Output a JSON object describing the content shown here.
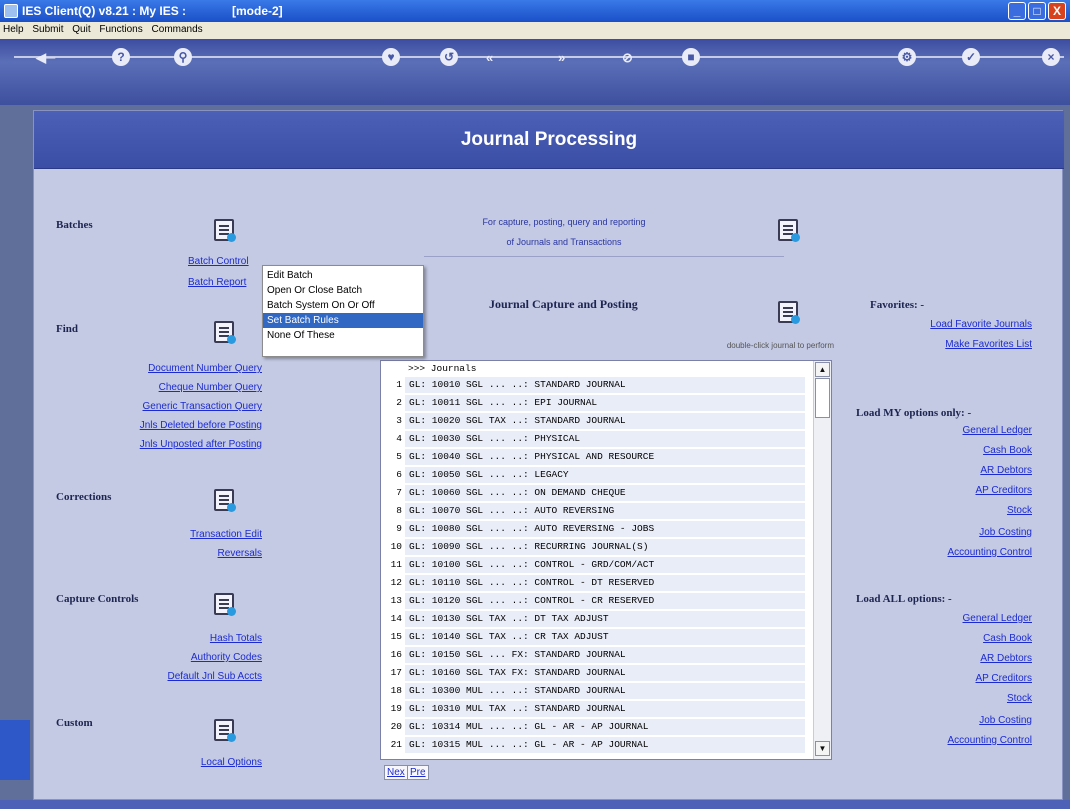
{
  "window": {
    "title": "IES Client(Q) v8.21 : My IES :",
    "mode": "[mode-2]",
    "controls": [
      "_",
      "□",
      "X"
    ]
  },
  "menu": [
    "Help",
    "Submit",
    "Quit",
    "Functions",
    "Commands"
  ],
  "toolbar": {
    "icons": [
      "back-icon",
      "help-icon",
      "search-icon",
      "favorite-icon",
      "undo-icon",
      "prev-icon",
      "next-icon",
      "stop-icon",
      "record-icon",
      "settings-icon",
      "confirm-icon",
      "close-icon"
    ]
  },
  "header": {
    "title": "Journal Processing"
  },
  "batches": {
    "title": "Batches",
    "links": [
      "Batch Control",
      "Batch Report"
    ]
  },
  "find": {
    "title": "Find",
    "links": [
      "Document Number Query",
      "Cheque Number Query",
      "Generic Transaction Query",
      "Jnls Deleted before Posting",
      "Jnls Unposted after Posting"
    ]
  },
  "corrections": {
    "title": "Corrections",
    "links": [
      "Transaction Edit",
      "Reversals"
    ]
  },
  "capture_controls": {
    "title": "Capture Controls",
    "links": [
      "Hash Totals",
      "Authority Codes",
      "Default Jnl Sub Accts"
    ]
  },
  "custom": {
    "title": "Custom",
    "links": [
      "Local Options"
    ]
  },
  "info": {
    "line1": "For capture, posting, query and reporting",
    "line2": "of Journals and Transactions"
  },
  "capture": {
    "title": "Journal Capture and Posting",
    "hint": "double-click journal to perform"
  },
  "favorites": {
    "title": "Favorites: -",
    "links": [
      "Load Favorite Journals",
      "Make Favorites List"
    ]
  },
  "load_my": {
    "title": "Load MY options only: -",
    "links": [
      "General Ledger",
      "Cash Book",
      "AR Debtors",
      "AP Creditors",
      "Stock",
      "Job Costing",
      "Accounting Control"
    ]
  },
  "load_all": {
    "title": "Load ALL options: -",
    "links": [
      "General Ledger",
      "Cash Book",
      "AR Debtors",
      "AP Creditors",
      "Stock",
      "Job Costing",
      "Accounting Control"
    ]
  },
  "context_menu": {
    "items": [
      "Edit Batch",
      "Open Or Close Batch",
      "Batch System On Or Off",
      "Set Batch Rules",
      "None Of These"
    ],
    "selected": "Set Batch Rules"
  },
  "journals": {
    "header": ">>> Journals",
    "rows": [
      {
        "n": "1",
        "t": "GL: 10010 SGL ... ..: STANDARD JOURNAL"
      },
      {
        "n": "2",
        "t": "GL: 10011 SGL ... ..: EPI JOURNAL"
      },
      {
        "n": "3",
        "t": "GL: 10020 SGL TAX ..: STANDARD JOURNAL"
      },
      {
        "n": "4",
        "t": "GL: 10030 SGL ... ..: PHYSICAL"
      },
      {
        "n": "5",
        "t": "GL: 10040 SGL ... ..: PHYSICAL AND RESOURCE"
      },
      {
        "n": "6",
        "t": "GL: 10050 SGL ... ..: LEGACY"
      },
      {
        "n": "7",
        "t": "GL: 10060 SGL ... ..: ON DEMAND CHEQUE"
      },
      {
        "n": "8",
        "t": "GL: 10070 SGL ... ..: AUTO REVERSING"
      },
      {
        "n": "9",
        "t": "GL: 10080 SGL ... ..: AUTO REVERSING - JOBS"
      },
      {
        "n": "10",
        "t": "GL: 10090 SGL ... ..: RECURRING JOURNAL(S)"
      },
      {
        "n": "11",
        "t": "GL: 10100 SGL ... ..: CONTROL - GRD/COM/ACT"
      },
      {
        "n": "12",
        "t": "GL: 10110 SGL ... ..: CONTROL - DT RESERVED"
      },
      {
        "n": "13",
        "t": "GL: 10120 SGL ... ..: CONTROL - CR RESERVED"
      },
      {
        "n": "14",
        "t": "GL: 10130 SGL TAX ..: DT TAX ADJUST"
      },
      {
        "n": "15",
        "t": "GL: 10140 SGL TAX ..: CR TAX ADJUST"
      },
      {
        "n": "16",
        "t": "GL: 10150 SGL ... FX: STANDARD JOURNAL"
      },
      {
        "n": "17",
        "t": "GL: 10160 SGL TAX FX: STANDARD JOURNAL"
      },
      {
        "n": "18",
        "t": "GL: 10300 MUL ... ..: STANDARD JOURNAL"
      },
      {
        "n": "19",
        "t": "GL: 10310 MUL TAX ..: STANDARD JOURNAL"
      },
      {
        "n": "20",
        "t": "GL: 10314 MUL ... ..: GL - AR - AP JOURNAL"
      },
      {
        "n": "21",
        "t": "GL: 10315 MUL ... ..: GL - AR - AP JOURNAL"
      }
    ],
    "nav": [
      "Nex",
      "Pre"
    ]
  }
}
